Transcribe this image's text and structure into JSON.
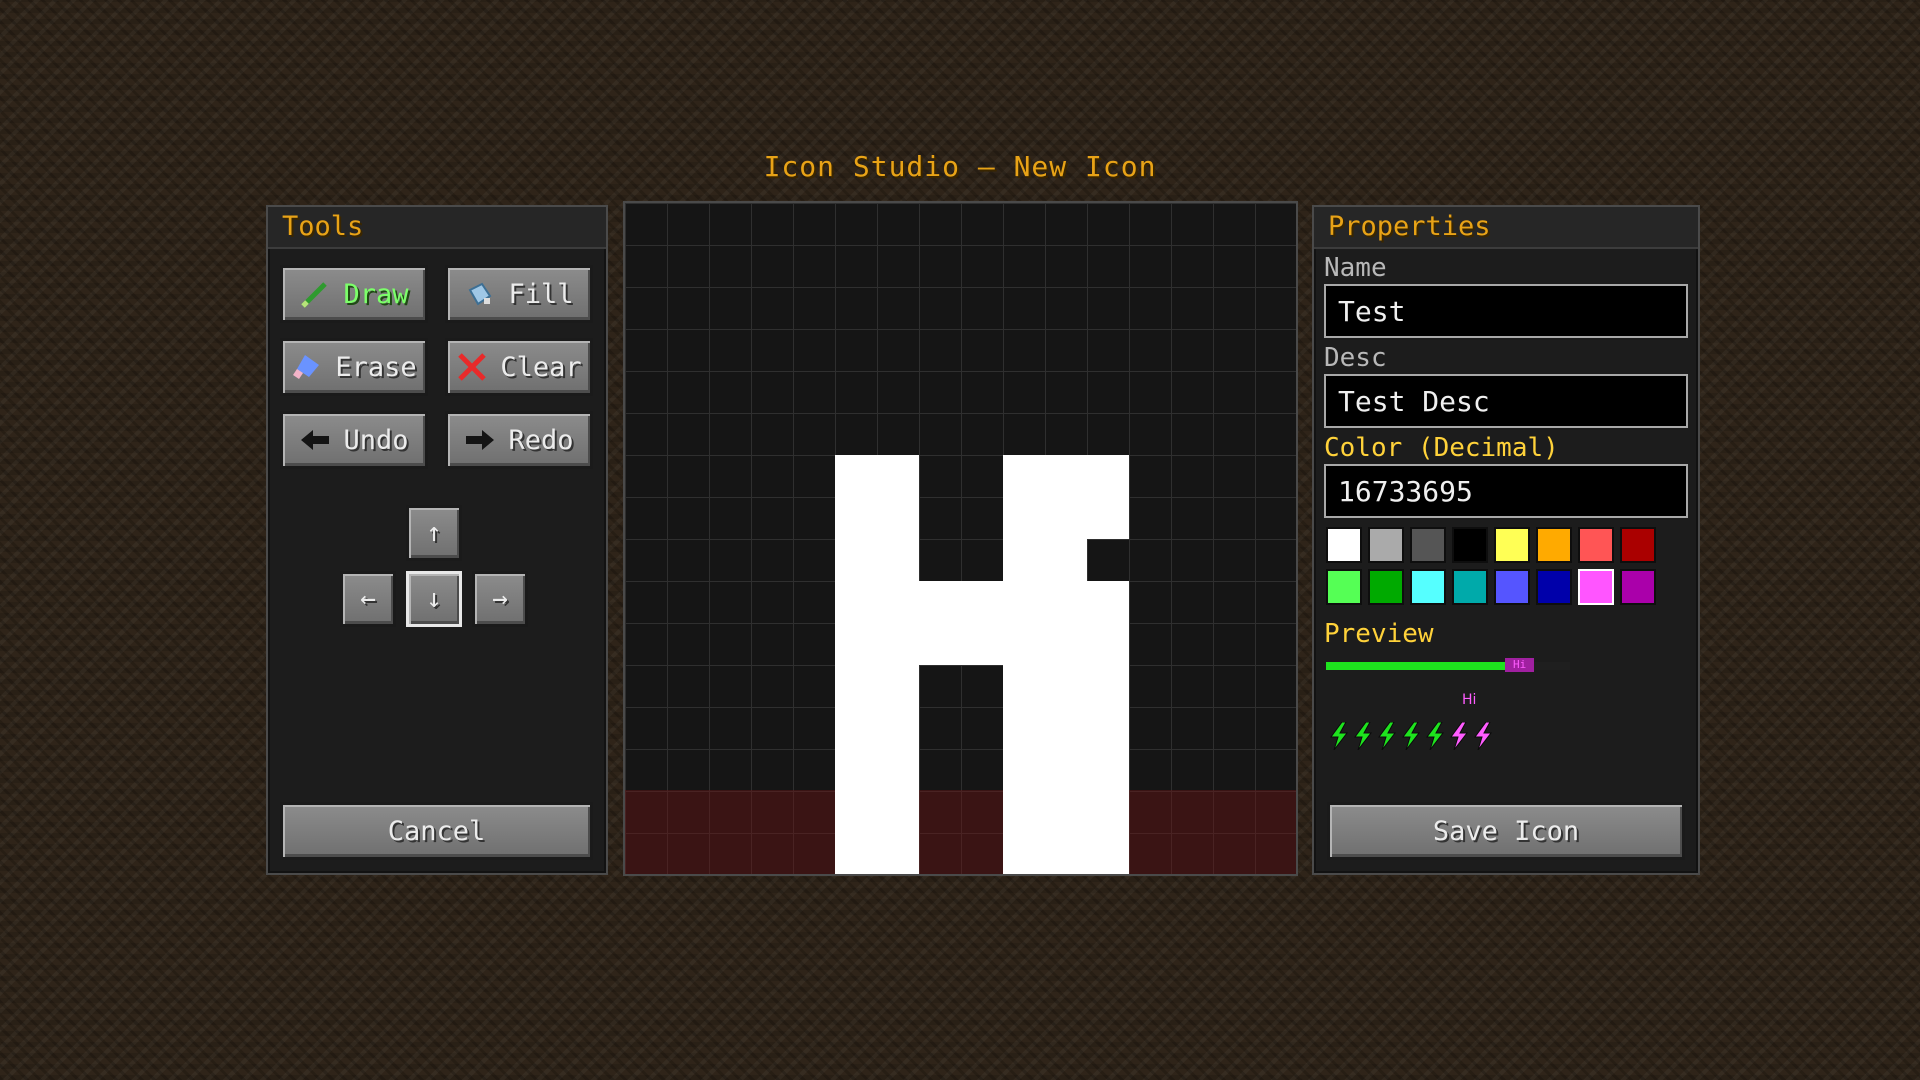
{
  "title": "Icon Studio — New Icon",
  "tools": {
    "header": "Tools",
    "buttons": {
      "draw": "Draw",
      "fill": "Fill",
      "erase": "Erase",
      "clear": "Clear",
      "undo": "Undo",
      "redo": "Redo"
    },
    "active_tool": "draw",
    "arrows": {
      "up": "↑",
      "left": "←",
      "down": "↓",
      "right": "→",
      "selected": "down"
    },
    "icons": {
      "draw": "pencil-icon",
      "fill": "bucket-icon",
      "erase": "eraser-icon",
      "clear": "red-x-icon",
      "undo": "left-arrow-icon",
      "redo": "right-arrow-icon"
    },
    "cancel": "Cancel"
  },
  "canvas": {
    "grid_size": 16,
    "pixel_color": "#ffffff",
    "pixels": [
      [
        5,
        6
      ],
      [
        5,
        7
      ],
      [
        5,
        8
      ],
      [
        5,
        9
      ],
      [
        5,
        10
      ],
      [
        5,
        11
      ],
      [
        5,
        12
      ],
      [
        5,
        13
      ],
      [
        5,
        14
      ],
      [
        5,
        15
      ],
      [
        6,
        6
      ],
      [
        6,
        7
      ],
      [
        6,
        8
      ],
      [
        6,
        9
      ],
      [
        6,
        10
      ],
      [
        6,
        11
      ],
      [
        6,
        12
      ],
      [
        6,
        13
      ],
      [
        6,
        14
      ],
      [
        6,
        15
      ],
      [
        7,
        9
      ],
      [
        7,
        10
      ],
      [
        8,
        9
      ],
      [
        8,
        10
      ],
      [
        9,
        6
      ],
      [
        9,
        7
      ],
      [
        9,
        8
      ],
      [
        9,
        9
      ],
      [
        9,
        10
      ],
      [
        9,
        11
      ],
      [
        9,
        12
      ],
      [
        9,
        13
      ],
      [
        9,
        14
      ],
      [
        9,
        15
      ],
      [
        10,
        6
      ],
      [
        10,
        7
      ],
      [
        10,
        8
      ],
      [
        10,
        9
      ],
      [
        10,
        10
      ],
      [
        10,
        11
      ],
      [
        10,
        12
      ],
      [
        10,
        13
      ],
      [
        10,
        14
      ],
      [
        10,
        15
      ],
      [
        11,
        6
      ],
      [
        11,
        7
      ],
      [
        11,
        9
      ],
      [
        11,
        10
      ],
      [
        11,
        11
      ],
      [
        11,
        12
      ],
      [
        11,
        13
      ],
      [
        11,
        14
      ],
      [
        11,
        15
      ]
    ]
  },
  "properties": {
    "header": "Properties",
    "name_label": "Name",
    "name_value": "Test",
    "desc_label": "Desc",
    "desc_value": "Test Desc",
    "color_label": "Color (Decimal)",
    "color_value": "16733695",
    "swatches": [
      "#ffffff",
      "#aaaaaa",
      "#555555",
      "#000000",
      "#ffff55",
      "#ffaa00",
      "#ff5555",
      "#aa0000",
      "#55ff55",
      "#00aa00",
      "#55ffff",
      "#00aaaa",
      "#5555ff",
      "#0000aa",
      "#ff55ff",
      "#aa00aa"
    ],
    "selected_swatch": 14,
    "preview_label": "Preview",
    "preview_bar_fill": 0.74,
    "preview_tag": "Hi",
    "preview_hi": "Hi",
    "bolts": {
      "total": 7,
      "green": 5,
      "green_color": "#1ee31e",
      "pink_color": "#ff5cff"
    },
    "save": "Save Icon"
  },
  "colors": {
    "accent": "#e8a317",
    "title_yellow": "#ffd23a",
    "active_tool_text": "#7cff6a"
  }
}
